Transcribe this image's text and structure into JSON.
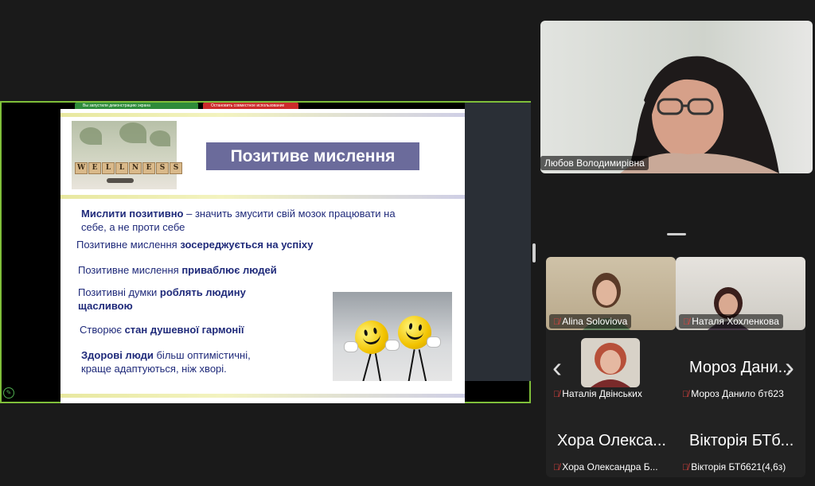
{
  "share": {
    "bar_green_text": "Вы запустили демонстрацию экрана",
    "bar_red_text": "Остановить совместное использование"
  },
  "slide": {
    "title": "Позитиве мислення",
    "wellness_letters": [
      "W",
      "E",
      "L",
      "L",
      "N",
      "E",
      "S",
      "S"
    ],
    "lines": [
      {
        "bold": "Мислити позитивно",
        "rest": " – значить змусити свій мозок працювати на"
      },
      {
        "bold": "",
        "rest": "себе, а не проти себе"
      },
      {
        "plain": "Позитивне мислення ",
        "bold": "зосереджується на успіху"
      },
      {
        "plain": "Позитивне мислення ",
        "bold": "приваблює людей"
      },
      {
        "plain": "Позитивні думки ",
        "bold": "роблять людину"
      },
      {
        "plain": "",
        "bold": "щасливою"
      },
      {
        "plain": "Створює ",
        "bold": "стан душевної гармонії"
      },
      {
        "bold": "Здорові люди",
        "rest": " більш оптимістичні,"
      },
      {
        "bold": "",
        "rest": "краще адаптуються, ніж хворі."
      }
    ]
  },
  "participants": {
    "speaker": "Любов Володимирівна",
    "tiles": [
      {
        "name": "Alina Soloviova"
      },
      {
        "name": "Наталя Хохленкова"
      },
      {
        "name": "Наталія Двінських"
      },
      {
        "name": "Мороз Данило бт623",
        "big": "Мороз Дани..."
      },
      {
        "name": "Хора Олександра Б...",
        "big": "Хора Олекса..."
      },
      {
        "name": "Вікторія БТб621(4,6з)",
        "big": "Вікторія БТб..."
      }
    ]
  },
  "icons": {
    "mic_off": "microphone-off-icon",
    "prev": "chevron-left-icon",
    "next": "chevron-right-icon",
    "edit": "pencil-icon"
  }
}
